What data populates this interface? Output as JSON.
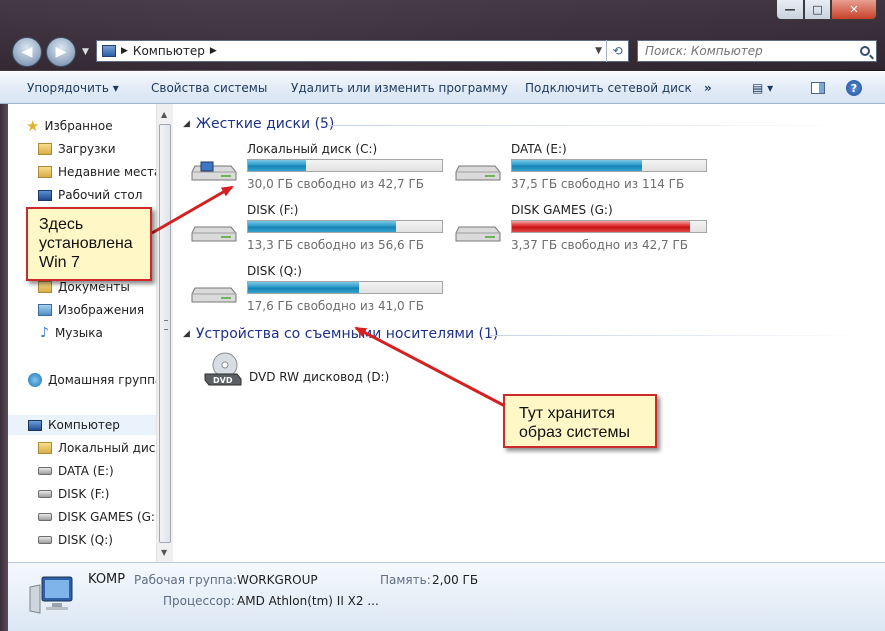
{
  "window": {
    "address": "Компьютер",
    "search_placeholder": "Поиск: Компьютер",
    "caption": {
      "min": "—",
      "max": "□",
      "close": "✕"
    }
  },
  "commandbar": {
    "organize": "Упорядочить ▾",
    "system_properties": "Свойства системы",
    "uninstall": "Удалить или изменить программу",
    "map_drive": "Подключить сетевой диск",
    "more": "»",
    "view": "▤ ▾",
    "help": "?"
  },
  "navpane": {
    "favorites": "Избранное",
    "downloads": "Загрузки",
    "recent": "Недавние места",
    "desktop": "Рабочий стол",
    "documents": "Документы",
    "pictures": "Изображения",
    "music": "Музыка",
    "homegroup": "Домашняя группа",
    "computer": "Компьютер",
    "drives": [
      "Локальный диск (C:)",
      "DATA  (E:)",
      "DISK (F:)",
      "DISK GAMES (G:)",
      "DISK (Q:)"
    ]
  },
  "content": {
    "hard_disks_header": "Жесткие диски (5)",
    "removable_header": "Устройства со съемными носителями (1)",
    "drives": [
      {
        "name": "Локальный диск (C:)",
        "free": "30,0 ГБ свободно из 42,7 ГБ",
        "used_fraction": 0.3,
        "color": "#1a8dbf"
      },
      {
        "name": "DATA  (E:)",
        "free": "37,5 ГБ свободно из 114 ГБ",
        "used_fraction": 0.67,
        "color": "#1a8dbf"
      },
      {
        "name": "DISK (F:)",
        "free": "13,3 ГБ свободно из 56,6 ГБ",
        "used_fraction": 0.765,
        "color": "#1a8dbf"
      },
      {
        "name": "DISK GAMES (G:)",
        "free": "3,37 ГБ свободно из 42,7 ГБ",
        "used_fraction": 0.92,
        "color": "#d21e1e"
      },
      {
        "name": "DISK (Q:)",
        "free": "17,6 ГБ свободно из 41,0 ГБ",
        "used_fraction": 0.57,
        "color": "#1a8dbf"
      }
    ],
    "dvd_name": "DVD RW дисковод (D:)",
    "dvd_icon_label": "DVD"
  },
  "details": {
    "computer_name": "KOMP",
    "workgroup_label": "Рабочая группа:",
    "workgroup": "WORKGROUP",
    "memory_label": "Память:",
    "memory": "2,00 ГБ",
    "cpu_label": "Процессор:",
    "cpu": "AMD Athlon(tm) II X2 ..."
  },
  "annotations": {
    "note1": [
      "Здесь",
      "установлена",
      "Win 7"
    ],
    "note2": [
      "Тут хранится",
      "образ системы"
    ],
    "arrow_color": "#d42020"
  }
}
